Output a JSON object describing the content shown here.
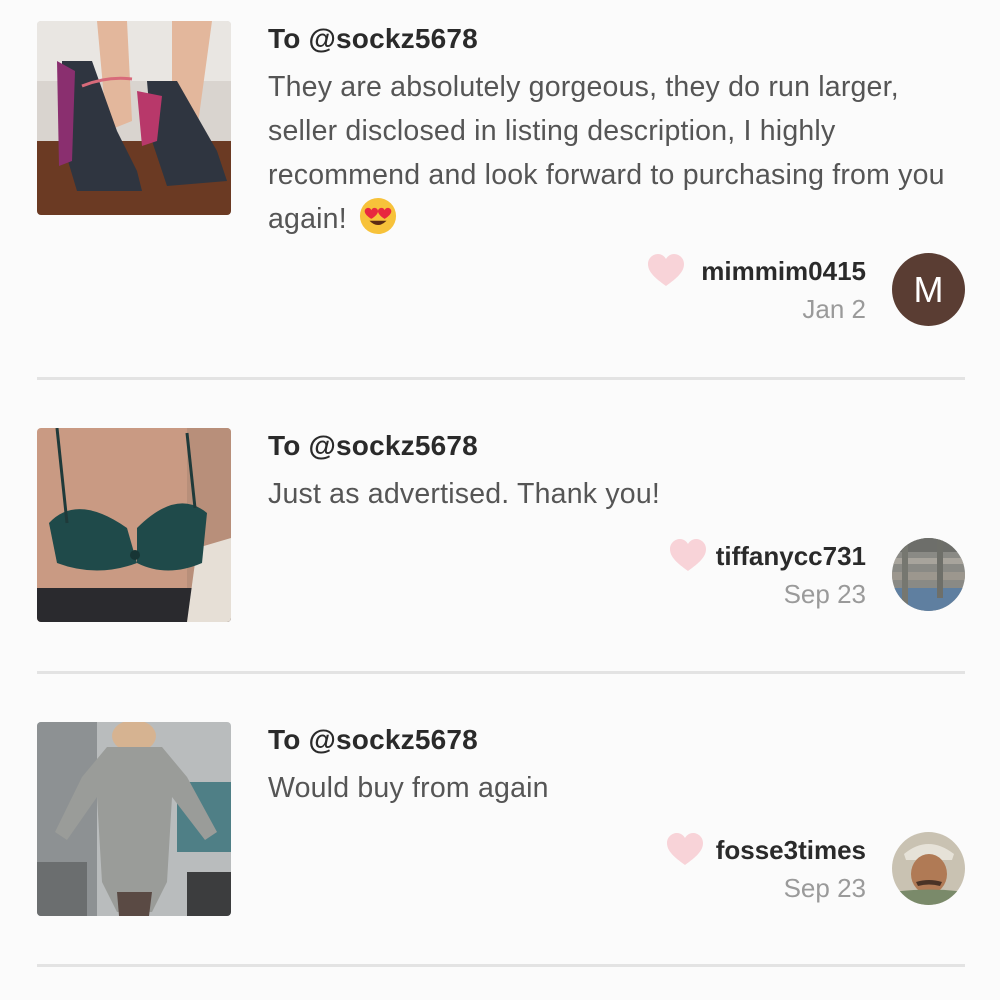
{
  "reviews": [
    {
      "to": "To @sockz5678",
      "comment": "They are absolutely gorgeous, they do run larger, seller disclosed in listing description, I highly recommend and look forward to purchasing from you again!",
      "emoji": "heart-eyes-emoji",
      "username": "mimmim0415",
      "date": "Jan 2",
      "avatar_letter": "M",
      "image": "high-heels-photo"
    },
    {
      "to": "To @sockz5678",
      "comment": "Just as advertised. Thank you!",
      "username": "tiffanycc731",
      "date": "Sep 23",
      "image": "bra-photo"
    },
    {
      "to": "To @sockz5678",
      "comment": "Would buy from again",
      "username": "fosse3times",
      "date": "Sep 23",
      "image": "bodysuit-photo"
    }
  ],
  "colors": {
    "heart": "#f8d3d8",
    "avatar_m": "#5a3d33",
    "divider": "#e3e3e3"
  }
}
